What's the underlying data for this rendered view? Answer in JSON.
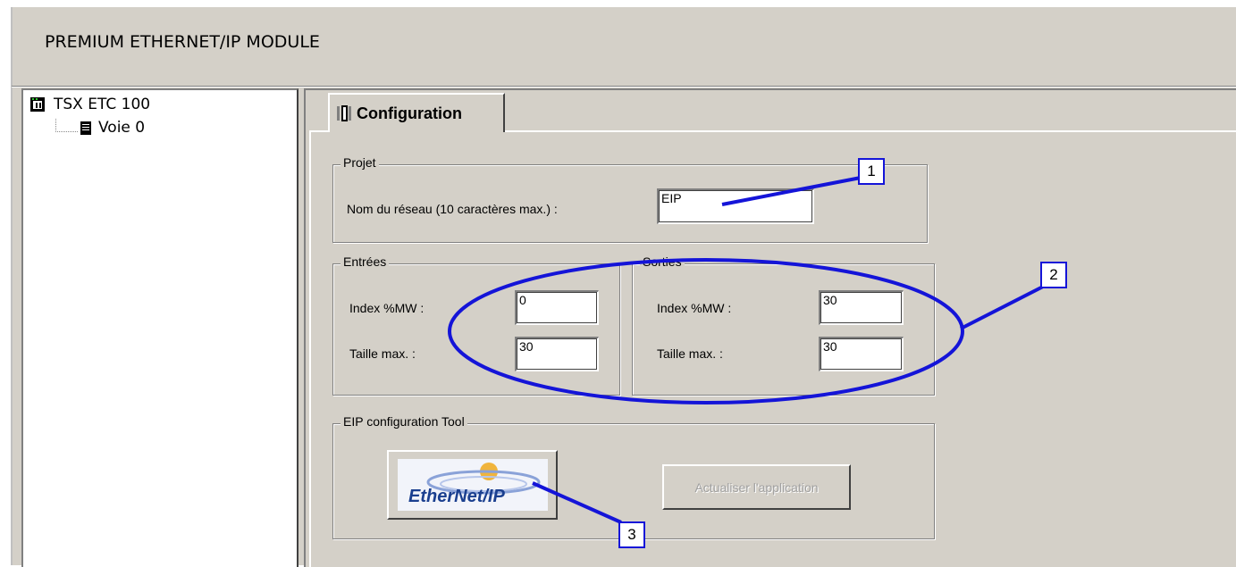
{
  "header": {
    "title": "PREMIUM ETHERNET/IP MODULE"
  },
  "tree": {
    "root_label": "TSX ETC 100",
    "child_label": "Voie 0"
  },
  "tab": {
    "label": "Configuration"
  },
  "projet": {
    "legend": "Projet",
    "network_name_label": "Nom du réseau (10 caractères max.) :",
    "network_name_value": "EIP"
  },
  "entrees": {
    "legend": "Entrées",
    "index_label": "Index %MW :",
    "index_value": "0",
    "size_label": "Taille max. :",
    "size_value": "30"
  },
  "sorties": {
    "legend": "Sorties",
    "index_label": "Index %MW :",
    "index_value": "30",
    "size_label": "Taille max. :",
    "size_value": "30"
  },
  "eip_tool": {
    "legend": "EIP configuration Tool",
    "logo_text": "EtherNet/IP",
    "update_button": "Actualiser l'application"
  },
  "callouts": {
    "c1": "1",
    "c2": "2",
    "c3": "3"
  },
  "colors": {
    "annotation_blue": "#1414d8",
    "window_gray": "#d4d0c8"
  }
}
